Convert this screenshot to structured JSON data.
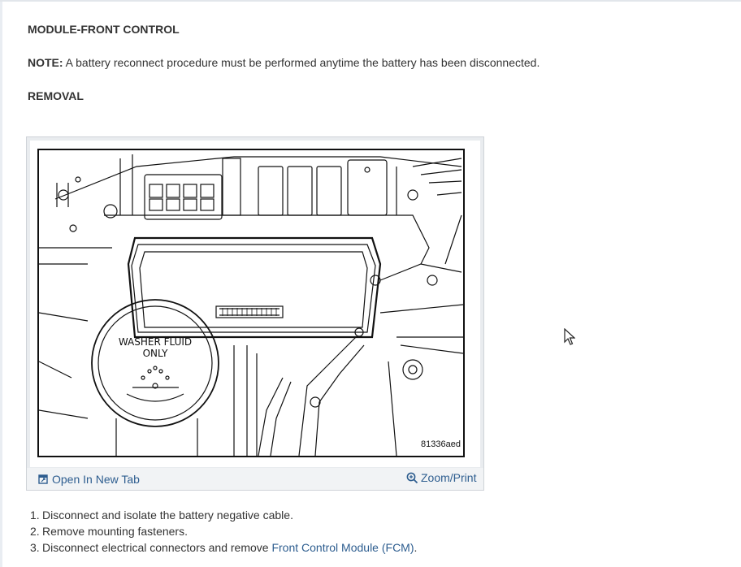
{
  "heading": "MODULE-FRONT CONTROL",
  "note": {
    "label": "NOTE:",
    "text": " A battery reconnect procedure must be performed anytime the battery has been disconnected."
  },
  "section": "REMOVAL",
  "figure": {
    "cap_text_line1": "WASHER FLUID",
    "cap_text_line2": "ONLY",
    "figure_id": "81336aed",
    "open_tab_label": "Open In New Tab",
    "zoom_label": "Zoom/Print",
    "icons": [
      "open-in-new-tab-icon",
      "zoom-icon"
    ]
  },
  "steps": [
    {
      "num": "1.",
      "text": "Disconnect and isolate the battery negative cable."
    },
    {
      "num": "2.",
      "text": "Remove mounting fasteners."
    },
    {
      "num": "3.",
      "pre": "Disconnect electrical connectors and remove ",
      "link": "Front Control Module (FCM)",
      "post": "."
    }
  ],
  "colors": {
    "link": "#2d5d8f",
    "text": "#333333",
    "figure_bg": "#e9ecef"
  }
}
